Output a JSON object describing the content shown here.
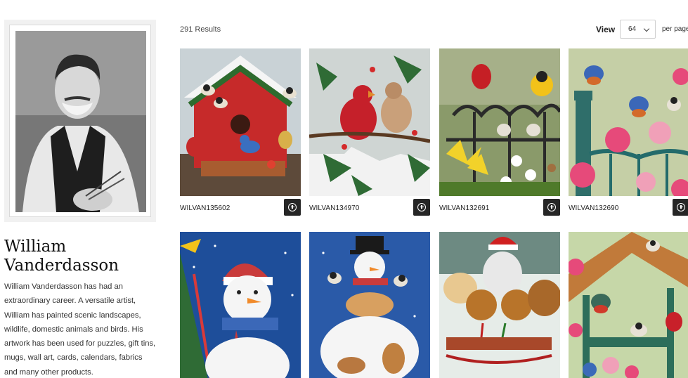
{
  "artist": {
    "name": "William Vanderdasson",
    "bio": "William Vanderdasson has had an extraordinary career.  A versatile artist, William has painted scenic landscapes, wildlife, domestic animals and birds. His artwork has been used for puzzles, gift tins, mugs, wall art, cards, calendars, fabrics and many other products."
  },
  "toolbar": {
    "results": "291 Results",
    "view_label": "View",
    "per_page_value": "64",
    "per_page_label": "per page"
  },
  "products": [
    {
      "sku": "WILVAN135602",
      "image": "birdhouse-winter-birds"
    },
    {
      "sku": "WILVAN134970",
      "image": "cardinals-holly"
    },
    {
      "sku": "WILVAN132691",
      "image": "birds-on-iron-fence-lilies"
    },
    {
      "sku": "WILVAN132690",
      "image": "bluebirds-hollyhocks"
    },
    {
      "sku": "",
      "image": "snowman-striped-hat"
    },
    {
      "sku": "",
      "image": "snowman-with-puppies"
    },
    {
      "sku": "",
      "image": "puppies-on-sled"
    },
    {
      "sku": "",
      "image": "bird-feeder-roof-flowers"
    }
  ],
  "colors": {
    "button_dark": "#262626",
    "text_primary": "#222222"
  }
}
